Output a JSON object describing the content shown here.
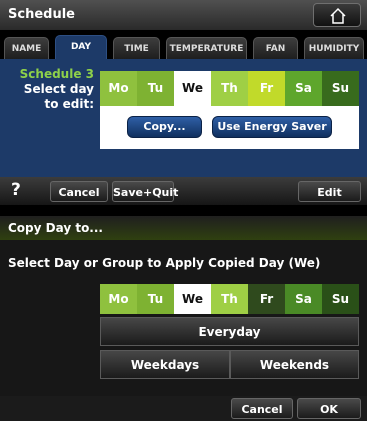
{
  "header": {
    "title": "Schedule",
    "home_icon": "home-outline-icon"
  },
  "tabs": [
    {
      "label": "NAME"
    },
    {
      "label": "DAY",
      "active": true
    },
    {
      "label": "TIME"
    },
    {
      "label": "TEMPERATURE"
    },
    {
      "label": "FAN"
    },
    {
      "label": "HUMIDITY"
    }
  ],
  "schedule": {
    "name": "Schedule 3",
    "prompt_line1": "Select day",
    "prompt_line2": "to edit:",
    "days": [
      {
        "label": "Mo",
        "color": "#8fc13e"
      },
      {
        "label": "Tu",
        "color": "#7eb232"
      },
      {
        "label": "We",
        "color": "#ffffff",
        "selected": true
      },
      {
        "label": "Th",
        "color": "#9fcf45"
      },
      {
        "label": "Fr",
        "color": "#c1da2a"
      },
      {
        "label": "Sa",
        "color": "#5ea62c"
      },
      {
        "label": "Su",
        "color": "#386b1d"
      }
    ],
    "copy_label": "Copy...",
    "energy_label": "Use Energy Saver"
  },
  "toolbar": {
    "help": "?",
    "cancel": "Cancel",
    "save_quit": "Save+Quit",
    "edit": "Edit"
  },
  "dialog": {
    "title": "Copy Day to...",
    "message": "Select Day or Group to Apply Copied Day (We)",
    "days": [
      {
        "label": "Mo",
        "color": "#8fc13e"
      },
      {
        "label": "Tu",
        "color": "#7eb232"
      },
      {
        "label": "We",
        "color": "#ffffff",
        "selected": true
      },
      {
        "label": "Th",
        "color": "#9fcf45"
      },
      {
        "label": "Fr",
        "color": "#2f4a1d"
      },
      {
        "label": "Sa",
        "color": "#4a8a26"
      },
      {
        "label": "Su",
        "color": "#2a5018"
      }
    ],
    "everyday": "Everyday",
    "weekdays": "Weekdays",
    "weekends": "Weekends",
    "cancel": "Cancel",
    "ok": "OK"
  }
}
